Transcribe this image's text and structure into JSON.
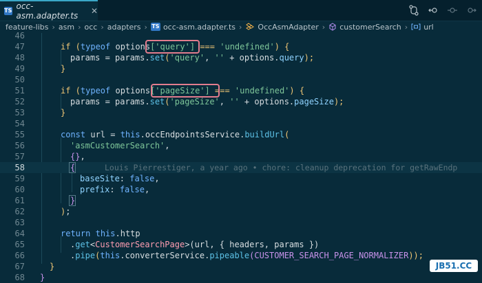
{
  "tab": {
    "badge": "TS",
    "label": "occ-asm.adapter.ts",
    "close": "✕"
  },
  "breadcrumbs": {
    "items": [
      "feature-libs",
      "asm",
      "occ",
      "adapters",
      "occ-asm.adapter.ts",
      "OccAsmAdapter",
      "customerSearch",
      "url"
    ],
    "ts_badge": "TS",
    "separator": "›"
  },
  "lines": [
    {
      "n": "46"
    },
    {
      "n": "47"
    },
    {
      "n": "48"
    },
    {
      "n": "49"
    },
    {
      "n": "50"
    },
    {
      "n": "51"
    },
    {
      "n": "52"
    },
    {
      "n": "53"
    },
    {
      "n": "54"
    },
    {
      "n": "55"
    },
    {
      "n": "56"
    },
    {
      "n": "57"
    },
    {
      "n": "58"
    },
    {
      "n": "59"
    },
    {
      "n": "60"
    },
    {
      "n": "61"
    },
    {
      "n": "62"
    },
    {
      "n": "63"
    },
    {
      "n": "64"
    },
    {
      "n": "65"
    },
    {
      "n": "66"
    },
    {
      "n": "67"
    },
    {
      "n": "68"
    }
  ],
  "code": {
    "l47": {
      "a": "if (",
      "b": "typeof",
      "c": " options",
      "d": "['query']",
      "e": " ",
      "f": "===",
      "g": " ",
      "h": "'undefined'",
      "i": ") {"
    },
    "l48": {
      "a": "params = params.",
      "b": "set",
      "c": "(",
      "d": "'query'",
      "e": ", ",
      "f": "''",
      "g": " + options.",
      "h": "query",
      "i": ");"
    },
    "l49": {
      "a": "}"
    },
    "l51": {
      "a": "if (",
      "b": "typeof",
      "c": " options",
      "d": "['pageSize']",
      "e": " ",
      "f": "===",
      "g": " ",
      "h": "'undefined'",
      "i": ") {"
    },
    "l52": {
      "a": "params = params.",
      "b": "set",
      "c": "(",
      "d": "'pageSize'",
      "e": ", ",
      "f": "''",
      "g": " + options.",
      "h": "pageSize",
      "i": ");"
    },
    "l53": {
      "a": "}"
    },
    "l55": {
      "a": "const",
      "b": " url = ",
      "c": "this",
      "d": ".occEndpointsService.",
      "e": "buildUrl",
      "f": "("
    },
    "l56": {
      "a": "'asmCustomerSearch'",
      "b": ","
    },
    "l57": {
      "a": "{}",
      "b": ","
    },
    "l58": {
      "a": "{"
    },
    "l59": {
      "a": "baseSite",
      "b": ": ",
      "c": "false",
      "d": ","
    },
    "l60": {
      "a": "prefix",
      "b": ": ",
      "c": "false",
      "d": ","
    },
    "l61": {
      "a": "}"
    },
    "l62": {
      "a": ")",
      "b": ";"
    },
    "l64": {
      "a": "return",
      "b": " ",
      "c": "this",
      "d": ".http"
    },
    "l65": {
      "a": ".",
      "b": "get",
      "c": "<",
      "d": "CustomerSearchPage",
      "e": ">(url, { headers, params })"
    },
    "l66": {
      "a": ".",
      "b": "pipe",
      "c": "(",
      "d": "this",
      "e": ".converterService.",
      "f": "pipeable",
      "g": "(",
      "h": "CUSTOMER_SEARCH_PAGE_NORMALIZER",
      "i": "));"
    },
    "l67": {
      "a": "}"
    },
    "l68": {
      "a": "}"
    }
  },
  "blame": "Louis Pierrestiger, a year ago • chore: cleanup deprecation for getRawEndp",
  "watermark": "JB51.CC"
}
